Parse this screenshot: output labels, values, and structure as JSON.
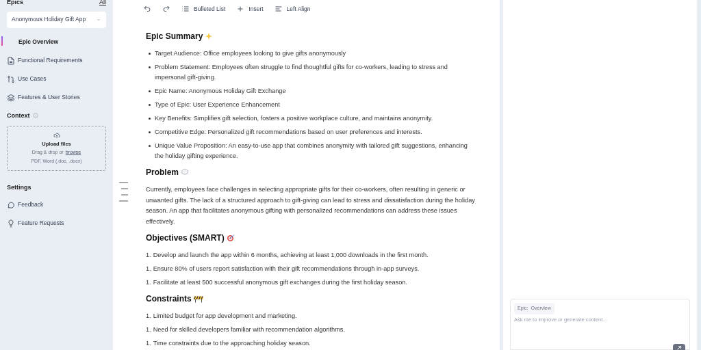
{
  "sidebar": {
    "epics_label": "Epics",
    "all_link": "All",
    "epic_select": {
      "value": "Anonymous Holiday Gift App"
    },
    "nav": [
      {
        "label": "Epic Overview",
        "selected": true
      },
      {
        "label": "Functional Requirements",
        "selected": false
      },
      {
        "label": "Use Cases",
        "selected": false
      },
      {
        "label": "Features & User Stories",
        "selected": false
      }
    ],
    "context_label": "Context",
    "upload": {
      "title": "Upload files",
      "hint": "Drag & drop or",
      "link": "browse",
      "formats": "PDF, Word (.doc, .docx)"
    },
    "settings_label": "Settings",
    "settings": [
      {
        "label": "Feedback"
      },
      {
        "label": "Feature Requests"
      }
    ]
  },
  "toolbar": [
    {
      "kind": "undo"
    },
    {
      "kind": "redo"
    },
    {
      "kind": "list",
      "label": "Bulleted List"
    },
    {
      "kind": "plus",
      "label": "Insert"
    },
    {
      "kind": "align",
      "label": "Left Align"
    }
  ],
  "document": [
    {
      "kind": "heading",
      "text": "Epic Summary"
    },
    {
      "kind": "bullets",
      "items": [
        "Target Audience: Office employees looking to give gifts anonymously",
        "Problem Statement: Employees often struggle to find thoughtful gifts for co-workers, leading to stress and impersonal gift-giving.",
        "Epic Name: Anonymous Holiday Gift Exchange",
        "Type of Epic: User Experience Enhancement",
        "Key Benefits: Simplifies gift selection, fosters a positive workplace culture, and maintains anonymity.",
        "Competitive Edge: Personalized gift recommendations based on user preferences and interests.",
        "Unique Value Proposition: An easy-to-use app that combines anonymity with tailored gift suggestions, enhancing the holiday gifting experience."
      ]
    },
    {
      "kind": "heading",
      "text": "Problem"
    },
    {
      "kind": "paragraph",
      "text": "Currently, employees face challenges in selecting appropriate gifts for their co-workers, often resulting in generic or unwanted gifts. The lack of a structured approach to gift-giving can lead to stress and dissatisfaction during the holiday season. An app that facilitates anonymous gifting with personalized recommendations can address these issues effectively."
    },
    {
      "kind": "heading",
      "text": "Objectives (SMART)"
    },
    {
      "kind": "numbered",
      "items": [
        {
          "marker": "1.",
          "text": "Develop and launch the app within 6 months, achieving at least 1,000 downloads in the first month."
        },
        {
          "marker": "1.",
          "text": "Ensure 80% of users report satisfaction with their gift recommendations through in-app surveys."
        },
        {
          "marker": "1.",
          "text": "Facilitate at least 500 successful anonymous gift exchanges during the first holiday season."
        }
      ]
    },
    {
      "kind": "heading",
      "text": "Constraints"
    },
    {
      "kind": "numbered",
      "items": [
        {
          "marker": "1.",
          "text": "Limited budget for app development and marketing."
        },
        {
          "marker": "1.",
          "text": "Need for skilled developers familiar with recommendation algorithms."
        },
        {
          "marker": "1.",
          "text": "Time constraints due to the approaching holiday season."
        }
      ]
    }
  ],
  "chat": {
    "chip_label": "Epic:",
    "chip_value": "Overview",
    "placeholder": "Ask me to improve or generate content..."
  }
}
